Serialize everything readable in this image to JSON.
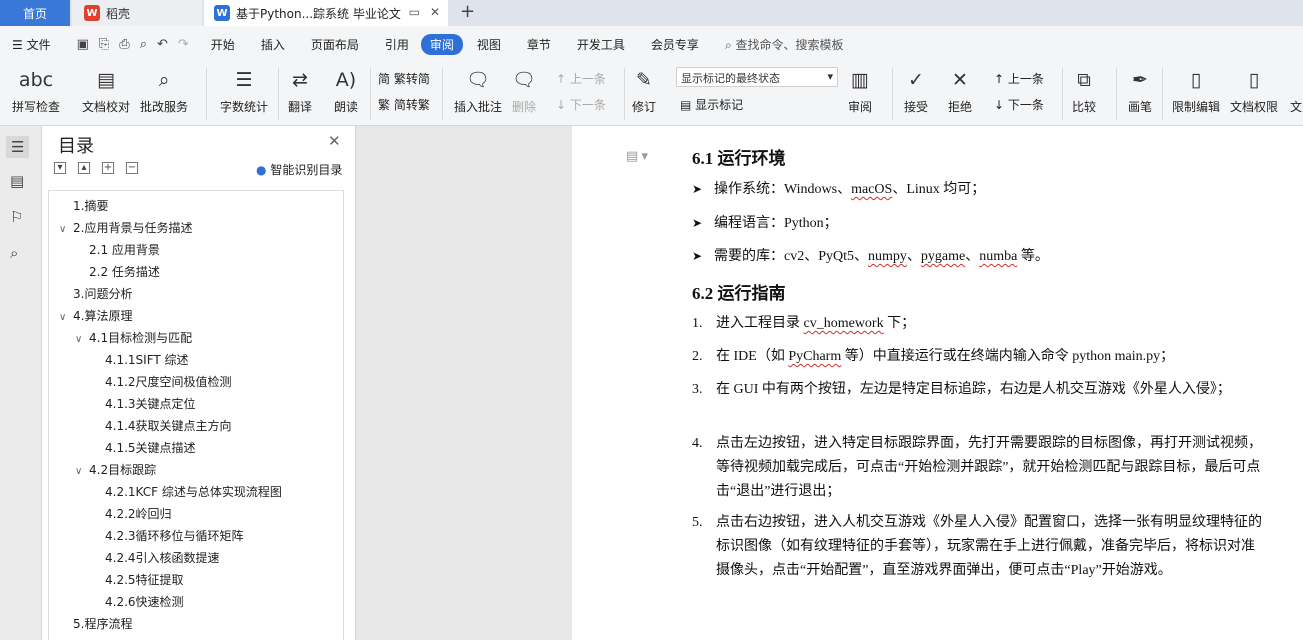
{
  "tabs": {
    "home": "首页",
    "wps": "稻壳",
    "doc": "基于Python...踪系统 毕业论文",
    "new_tab": "+"
  },
  "menu": {
    "file": "文件",
    "items": [
      "开始",
      "插入",
      "页面布局",
      "引用",
      "审阅",
      "视图",
      "章节",
      "开发工具",
      "会员专享"
    ],
    "active": "审阅",
    "search": "查找命令、搜索模板"
  },
  "ribbon": {
    "spell": "拼写检查",
    "proof": "文档校对",
    "batch": "批改服务",
    "wordcount": "字数统计",
    "translate": "翻译",
    "read": "朗读",
    "trad": "繁转简",
    "simp": "简转繁",
    "insert_comment": "插入批注",
    "delete": "删除",
    "prev": "上一条",
    "next": "下一条",
    "revise": "修订",
    "show_markup": "显示标记",
    "markup_mode": "显示标记的最终状态",
    "review": "审阅",
    "accept": "接受",
    "reject": "拒绝",
    "prev2": "上一条",
    "next2": "下一条",
    "compare": "比较",
    "pen": "画笔",
    "restrict": "限制编辑",
    "perm": "文档权限",
    "more": "文"
  },
  "nav": {
    "title": "目录",
    "smart": "智能识别目录"
  },
  "toc": [
    {
      "label": "1.摘要",
      "level": 0,
      "twisty": ""
    },
    {
      "label": "2.应用背景与任务描述",
      "level": 0,
      "twisty": "∨"
    },
    {
      "label": "2.1 应用背景",
      "level": 1,
      "twisty": ""
    },
    {
      "label": "2.2 任务描述",
      "level": 1,
      "twisty": ""
    },
    {
      "label": "3.问题分析",
      "level": 0,
      "twisty": ""
    },
    {
      "label": "4.算法原理",
      "level": 0,
      "twisty": "∨"
    },
    {
      "label": "4.1目标检测与匹配",
      "level": 1,
      "twisty": "∨"
    },
    {
      "label": "4.1.1SIFT 综述",
      "level": 2,
      "twisty": ""
    },
    {
      "label": "4.1.2尺度空间极值检测",
      "level": 2,
      "twisty": ""
    },
    {
      "label": "4.1.3关键点定位",
      "level": 2,
      "twisty": ""
    },
    {
      "label": "4.1.4获取关键点主方向",
      "level": 2,
      "twisty": ""
    },
    {
      "label": "4.1.5关键点描述",
      "level": 2,
      "twisty": ""
    },
    {
      "label": "4.2目标跟踪",
      "level": 1,
      "twisty": "∨"
    },
    {
      "label": "4.2.1KCF 综述与总体实现流程图",
      "level": 2,
      "twisty": ""
    },
    {
      "label": "4.2.2岭回归",
      "level": 2,
      "twisty": ""
    },
    {
      "label": "4.2.3循环移位与循环矩阵",
      "level": 2,
      "twisty": ""
    },
    {
      "label": "4.2.4引入核函数提速",
      "level": 2,
      "twisty": ""
    },
    {
      "label": "4.2.5特征提取",
      "level": 2,
      "twisty": ""
    },
    {
      "label": "4.2.6快速检测",
      "level": 2,
      "twisty": ""
    },
    {
      "label": "5.程序流程",
      "level": 0,
      "twisty": ""
    }
  ],
  "doc": {
    "h1": "6.1 运行环境",
    "b1a": "操作系统：Windows、",
    "b1b": "macOS",
    "b1c": "、Linux 均可；",
    "b2": "编程语言：Python；",
    "b3a": "需要的库：cv2、PyQt5、",
    "b3b": "numpy",
    "b3c": "、",
    "b3d": "pygame",
    "b3e": "、",
    "b3f": "numba",
    "b3g": " 等。",
    "h2": "6.2 运行指南",
    "n1a": "进入工程目录 ",
    "n1b": "cv_homework",
    "n1c": " 下；",
    "n2a": "在 IDE（如 ",
    "n2b": "PyCharm",
    "n2c": " 等）中直接运行或在终端内输入命令 python main.py；",
    "n3": "在 GUI 中有两个按钮，左边是特定目标追踪，右边是人机交互游戏《外星人入侵》；",
    "n4": "点击左边按钮，进入特定目标跟踪界面，先打开需要跟踪的目标图像，再打开测试视频，等待视频加载完成后，可点击“开始检测并跟踪”，就开始检测匹配与跟踪目标，最后可点击“退出”进行退出；",
    "n5": "点击右边按钮，进入人机交互游戏《外星人入侵》配置窗口，选择一张有明显纹理特征的标识图像（如有纹理特征的手套等），玩家需在手上进行佩戴，准备完毕后，将标识对准摄像头，点击“开始配置”，直至游戏界面弹出，便可点击“Play”开始游戏。"
  },
  "colors": {
    "accent": "#2f6fd8",
    "home_tab": "#3a78d8",
    "squiggle": "#d03030"
  }
}
